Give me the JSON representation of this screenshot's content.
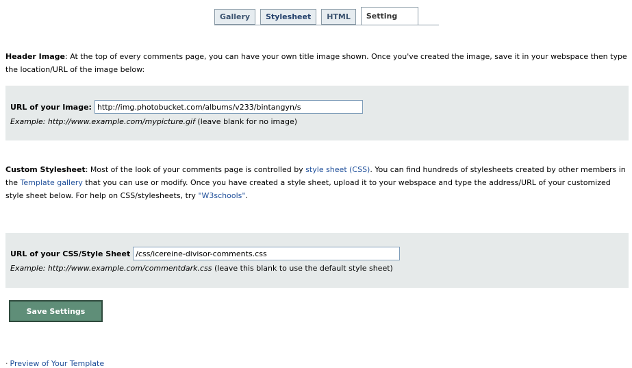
{
  "tabs": [
    {
      "label": "Gallery"
    },
    {
      "label": "Stylesheet"
    },
    {
      "label": "HTML"
    },
    {
      "label": "Setting"
    }
  ],
  "header_image": {
    "heading": "Header Image",
    "description": ": At the top of every comments page, you can have your own title image shown. Once you've created the image, save it in your webspace then type the location/URL of the image below:",
    "field_label": "URL of your Image:",
    "field_value": "http://img.photobucket.com/albums/v233/bintangyn/s",
    "example_italic": "Example: http://www.example.com/mypicture.gif",
    "example_note": " (leave blank for no image)"
  },
  "custom_stylesheet": {
    "heading": "Custom Stylesheet",
    "text_1": ": Most of the look of your comments page is controlled by ",
    "link_css": "style sheet (CSS)",
    "text_2": ". You can find hundreds of stylesheets created by other members in the ",
    "link_gallery": "Template gallery",
    "text_3": " that you can use or modify. Once you have created a style sheet, upload it to your webspace and type the address/URL of your customized style sheet below. For help on CSS/stylesheets, try ",
    "link_w3": "\"W3schools\"",
    "text_4": ".",
    "field_label": "URL of your CSS/Style Sheet",
    "field_value": "/css/icereine-divisor-comments.css",
    "example_italic": "Example: http://www.example.com/commentdark.css",
    "example_note": " (leave this blank to use the default style sheet)"
  },
  "save_button": {
    "label": "Save Settings"
  },
  "preview": {
    "bullet": "·",
    "label": "Preview of Your Template"
  }
}
